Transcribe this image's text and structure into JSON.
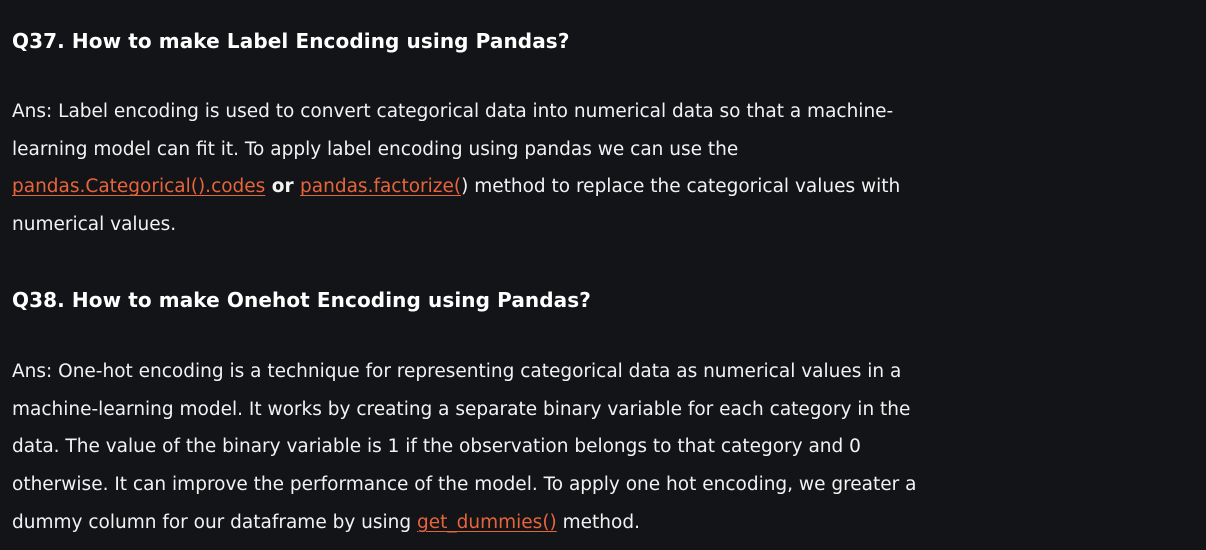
{
  "q37": {
    "title": "Q37. How to make Label Encoding using Pandas?",
    "line1": "Ans: Label encoding is used to convert categorical data into numerical data so that a machine-",
    "line2": "learning model can fit it. To apply label encoding using pandas we can use the",
    "link1": "pandas.Categorical().codes",
    "or_text": " or ",
    "link2": "pandas.factorize(",
    "after_link2": ") method to replace the categorical values with",
    "line4": "numerical values."
  },
  "q38": {
    "title": "Q38. How to make Onehot Encoding using Pandas?",
    "line1": "Ans: One-hot encoding is a technique for representing categorical data as numerical values in a",
    "line2": "machine-learning model. It works by creating a separate binary variable for each category in the",
    "line3": "data. The value of the binary variable is 1 if the observation belongs to that category and 0",
    "line4": "otherwise. It can improve the performance of the model. To apply one hot encoding, we greater a",
    "line5_before": "dummy column for our dataframe by using ",
    "link": "get_dummies()",
    "line5_after": " method."
  },
  "colors": {
    "background": "#131417",
    "text": "#ffffff",
    "link": "#e8643a"
  }
}
